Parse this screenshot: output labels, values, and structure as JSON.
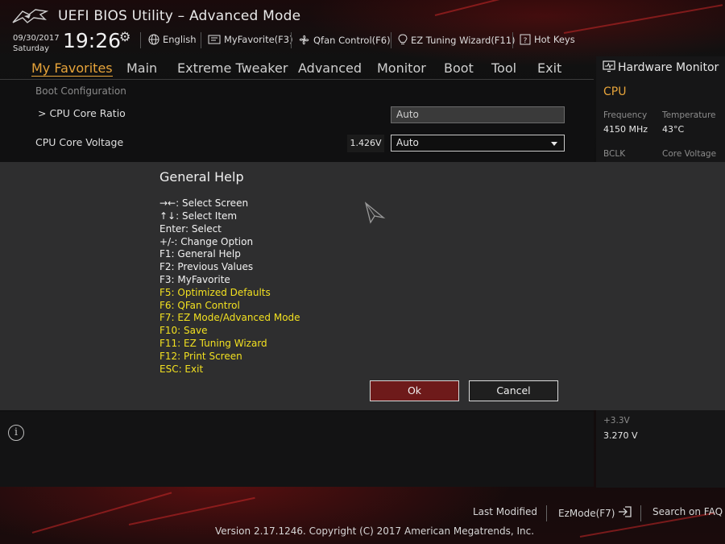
{
  "header": {
    "title": "UEFI BIOS Utility – Advanced Mode",
    "date": "09/30/2017",
    "day": "Saturday",
    "time": "19:26",
    "items": {
      "language": "English",
      "myfavorite": "MyFavorite(F3)",
      "qfan": "Qfan Control(F6)",
      "ez_tuning": "EZ Tuning Wizard(F11)",
      "hotkeys": "Hot Keys"
    }
  },
  "nav": {
    "tabs": [
      "My Favorites",
      "Main",
      "Extreme Tweaker",
      "Advanced",
      "Monitor",
      "Boot",
      "Tool",
      "Exit"
    ],
    "active": "My Favorites"
  },
  "main": {
    "section": "Boot Configuration",
    "cpu_core_ratio": {
      "label": "> CPU Core Ratio",
      "value": "Auto"
    },
    "cpu_core_voltage": {
      "label": "CPU Core Voltage",
      "reading": "1.426V",
      "value": "Auto"
    }
  },
  "hw_monitor": {
    "title": "Hardware Monitor",
    "section": "CPU",
    "frequency_label": "Frequency",
    "frequency_value": "4150 MHz",
    "temperature_label": "Temperature",
    "temperature_value": "43°C",
    "bclk_label": "BCLK",
    "core_voltage_label": "Core Voltage",
    "v33_label": "+3.3V",
    "v33_value": "3.270 V"
  },
  "dialog": {
    "title": "General Help",
    "lines": [
      "→←: Select Screen",
      "↑↓: Select Item",
      "Enter: Select",
      "+/-: Change Option",
      "F1: General Help",
      "F2: Previous Values",
      "F3: MyFavorite",
      "F5: Optimized Defaults",
      "F6: QFan Control",
      "F7: EZ Mode/Advanced Mode",
      "F10: Save",
      "F11: EZ Tuning Wizard",
      "F12: Print Screen",
      "ESC: Exit"
    ],
    "ok_label": "Ok",
    "cancel_label": "Cancel"
  },
  "footer": {
    "last_modified": "Last Modified",
    "ezmode": "EzMode(F7)",
    "search_faq": "Search on FAQ",
    "version": "Version 2.17.1246. Copyright (C) 2017 American Megatrends, Inc."
  },
  "colors": {
    "accent": "#e7a43a",
    "highlight_text": "#f2e020",
    "ok_button": "#6e1a1a",
    "dialog_bg": "#2e2e2f"
  },
  "icons": [
    "rog-logo-icon",
    "gear-icon",
    "globe-icon",
    "myfavorite-icon",
    "fan-icon",
    "bulb-icon",
    "hotkeys-icon",
    "monitor-icon",
    "info-icon",
    "exit-arrow-icon",
    "mouse-cursor-icon"
  ]
}
